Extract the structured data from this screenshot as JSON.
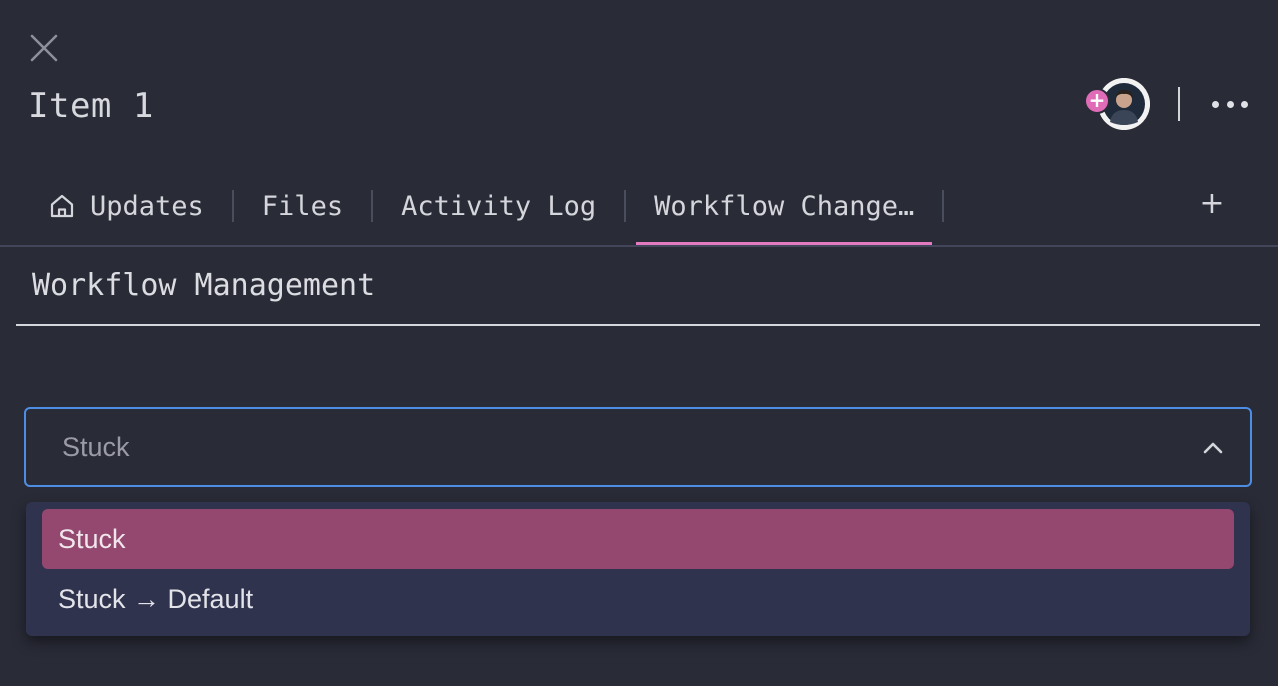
{
  "header": {
    "title": "Item 1",
    "close_icon": "close-icon",
    "add_person_icon": "plus-icon",
    "more_icon": "more-horizontal-icon"
  },
  "tabs": [
    {
      "label": "Updates",
      "icon": "home-icon",
      "active": false
    },
    {
      "label": "Files",
      "active": false
    },
    {
      "label": "Activity Log",
      "active": false
    },
    {
      "label": "Workflow Change…",
      "active": true
    }
  ],
  "tab_add_label": "+",
  "section": {
    "title": "Workflow Management"
  },
  "select": {
    "value": "Stuck",
    "expanded": true,
    "options": [
      {
        "label": "Stuck",
        "selected": true
      },
      {
        "label": "Stuck → Default",
        "selected": false
      }
    ]
  },
  "colors": {
    "background": "#292b37",
    "accent_pink": "#e27abf",
    "focus_blue": "#4e8de4",
    "dropdown_bg": "#30334d",
    "selected_option_bg": "#944870"
  }
}
